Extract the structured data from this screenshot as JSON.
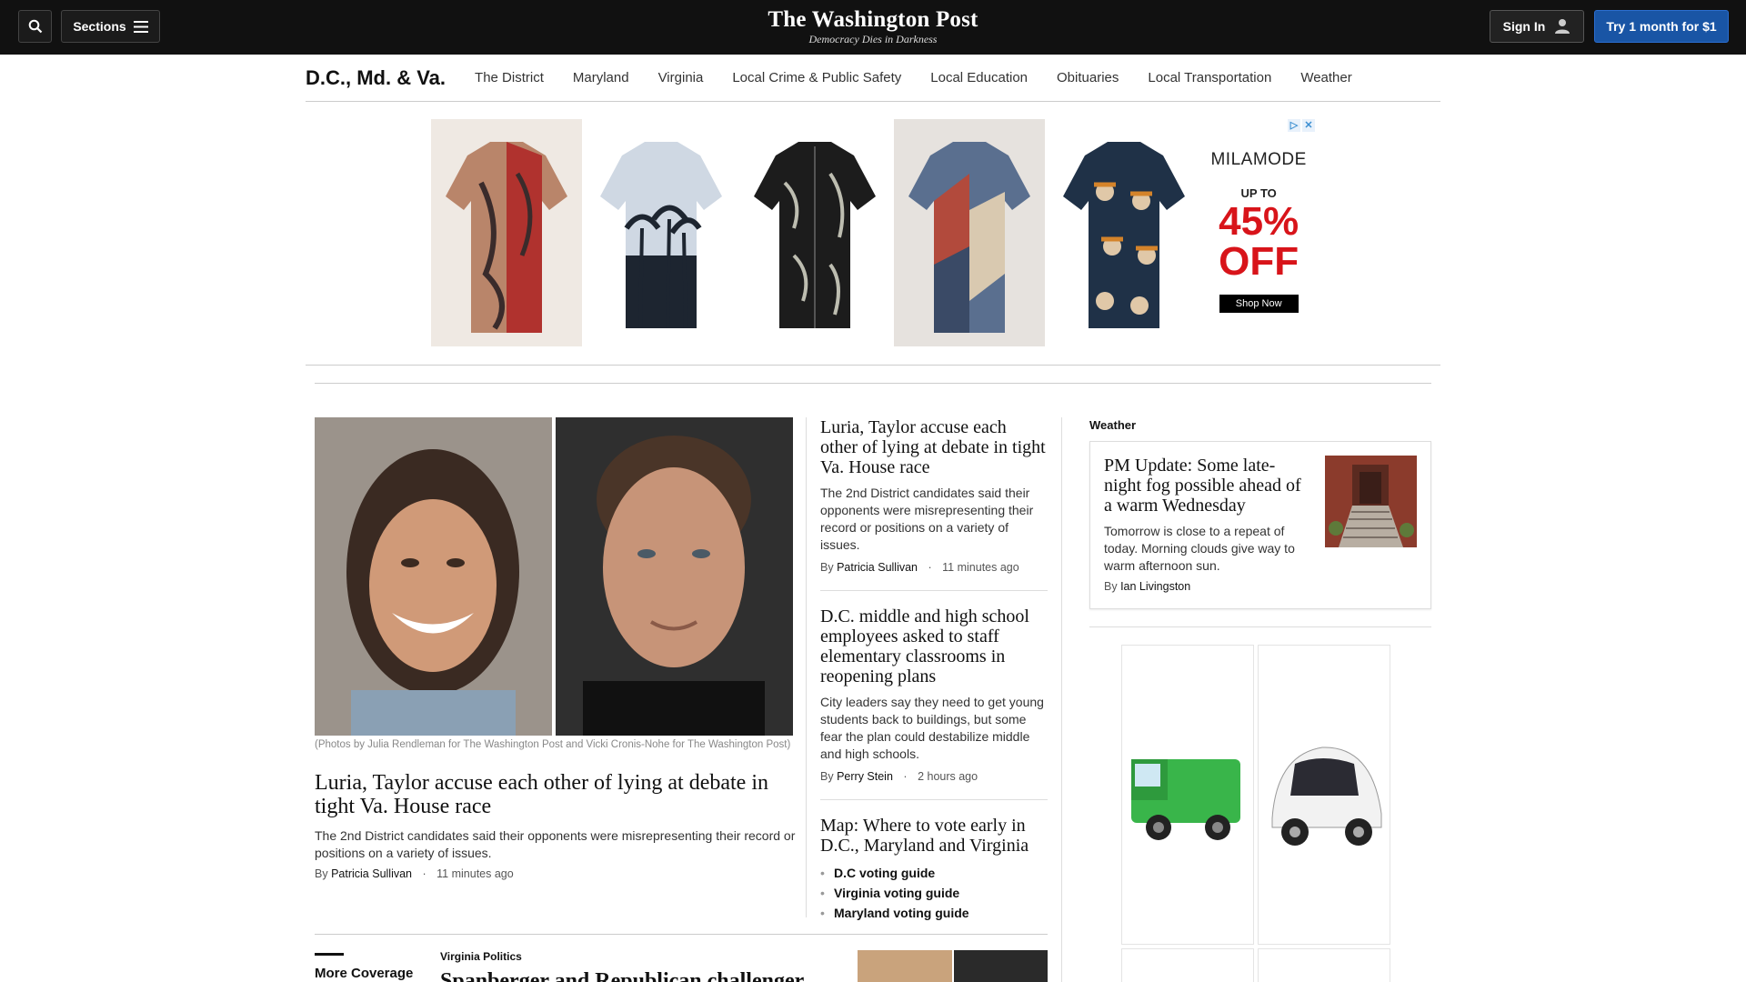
{
  "header": {
    "sections_label": "Sections",
    "logo_name": "The Washington Post",
    "logo_tagline": "Democracy Dies in Darkness",
    "signin_label": "Sign In",
    "trial_label": "Try 1 month for $1"
  },
  "section_nav": {
    "title": "D.C., Md. & Va.",
    "links": [
      "The District",
      "Maryland",
      "Virginia",
      "Local Crime & Public Safety",
      "Local Education",
      "Obituaries",
      "Local Transportation",
      "Weather"
    ]
  },
  "top_ad": {
    "brand": "MILAMODE",
    "up_to": "UP TO",
    "discount": "45%",
    "off": "OFF",
    "cta": "Shop Now"
  },
  "lead_story": {
    "caption": "(Photos by Julia Rendleman for The Washington Post and Vicki Cronis-Nohe for The Washington Post)",
    "headline": "Luria, Taylor accuse each other of lying at debate in tight Va. House race",
    "blurb": "The 2nd District candidates said their opponents were misrepresenting their record or positions on a variety of issues.",
    "by": "By",
    "author": "Patricia Sullivan",
    "time": "11 minutes ago"
  },
  "middle_stories": [
    {
      "headline": "Luria, Taylor accuse each other of lying at debate in tight Va. House race",
      "blurb": "The 2nd District candidates said their opponents were misrepresenting their record or positions on a variety of issues.",
      "by": "By",
      "author": "Patricia Sullivan",
      "time": "11 minutes ago"
    },
    {
      "headline": "D.C. middle and high school employees asked to staff elementary classrooms in reopening plans",
      "blurb": "City leaders say they need to get young students back to buildings, but some fear the plan could destabilize middle and high schools.",
      "by": "By",
      "author": "Perry Stein",
      "time": "2 hours ago"
    },
    {
      "headline": "Map: Where to vote early in D.C., Maryland and Virginia",
      "guides": [
        "D.C voting guide",
        "Virginia voting guide",
        "Maryland voting guide"
      ]
    }
  ],
  "weather": {
    "label": "Weather",
    "headline": "PM Update: Some late-night fog possible ahead of a warm Wednesday",
    "blurb": "Tomorrow is close to a repeat of today. Morning clouds give way to warm afternoon sun.",
    "by": "By",
    "author": "Ian Livingston"
  },
  "bottom": {
    "more_coverage": "More Coverage",
    "kicker": "Virginia Politics",
    "headline": "Spanberger and Republican challenger"
  },
  "colors": {
    "topbar": "#111111",
    "trial_button": "#1955a5",
    "discount_red": "#d8141a",
    "adchoices_blue": "#3c8fd1"
  }
}
